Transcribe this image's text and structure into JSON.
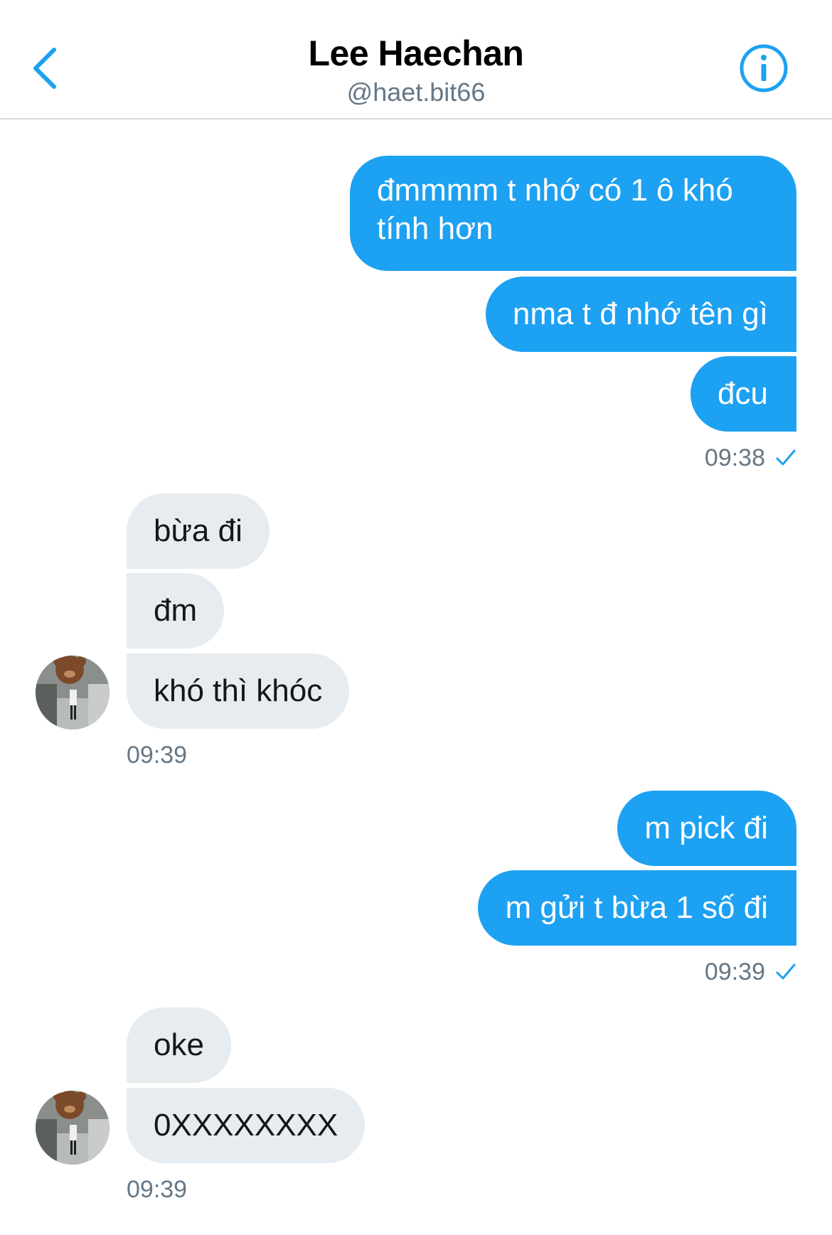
{
  "header": {
    "title": "Lee Haechan",
    "handle": "@haet.bit66",
    "back_icon": "chevron-left-icon",
    "info_icon": "info-icon"
  },
  "colors": {
    "accent": "#1da1f2",
    "received_bubble": "#e6ecf0",
    "timestamp": "#657786"
  },
  "messages": [
    {
      "sender": "me",
      "text": "đmmmm t nhớ có 1 ô khó tính hơn"
    },
    {
      "sender": "me",
      "text": "nma t đ nhớ tên gì"
    },
    {
      "sender": "me",
      "text": "đcu"
    },
    {
      "sender": "them",
      "text": "bừa đi"
    },
    {
      "sender": "them",
      "text": "đm"
    },
    {
      "sender": "them",
      "text": "khó thì khóc"
    },
    {
      "sender": "me",
      "text": "m pick đi"
    },
    {
      "sender": "me",
      "text": "m gửi t bừa 1 số đi"
    },
    {
      "sender": "them",
      "text": "oke"
    },
    {
      "sender": "them",
      "text": "0XXXXXXXX"
    }
  ],
  "timestamps": [
    "09:38",
    "09:39",
    "09:39",
    "09:39"
  ],
  "read_receipt_icon": "checkmark-icon"
}
